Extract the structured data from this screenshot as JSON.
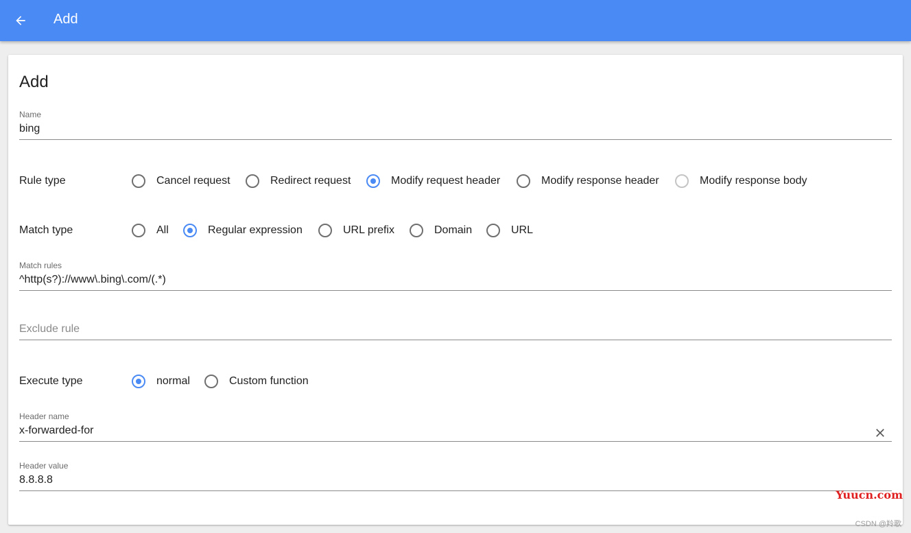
{
  "appbar": {
    "title": "Add",
    "back_icon": "arrow-left-icon"
  },
  "form": {
    "title": "Add",
    "name": {
      "label": "Name",
      "value": "bing"
    },
    "rule_type": {
      "label": "Rule type",
      "options": [
        {
          "label": "Cancel request",
          "checked": false,
          "disabled": false
        },
        {
          "label": "Redirect request",
          "checked": false,
          "disabled": false
        },
        {
          "label": "Modify request header",
          "checked": true,
          "disabled": false
        },
        {
          "label": "Modify response header",
          "checked": false,
          "disabled": false
        },
        {
          "label": "Modify response body",
          "checked": false,
          "disabled": true
        }
      ]
    },
    "match_type": {
      "label": "Match type",
      "options": [
        {
          "label": "All",
          "checked": false
        },
        {
          "label": "Regular expression",
          "checked": true
        },
        {
          "label": "URL prefix",
          "checked": false
        },
        {
          "label": "Domain",
          "checked": false
        },
        {
          "label": "URL",
          "checked": false
        }
      ]
    },
    "match_rules": {
      "label": "Match rules",
      "value": "^http(s?)://www\\.bing\\.com/(.*)"
    },
    "exclude_rule": {
      "placeholder": "Exclude rule",
      "value": ""
    },
    "execute_type": {
      "label": "Execute type",
      "options": [
        {
          "label": "normal",
          "checked": true
        },
        {
          "label": "Custom function",
          "checked": false
        }
      ]
    },
    "header_name": {
      "label": "Header name",
      "value": "x-forwarded-for",
      "clear_icon": "close-icon"
    },
    "header_value": {
      "label": "Header value",
      "value": "8.8.8.8"
    }
  },
  "watermarks": {
    "site": "Yuucn.com",
    "credit": "CSDN @羚歌"
  },
  "colors": {
    "primary": "#4a8af4",
    "text": "#212121",
    "secondary_text": "#6b6b6b"
  }
}
